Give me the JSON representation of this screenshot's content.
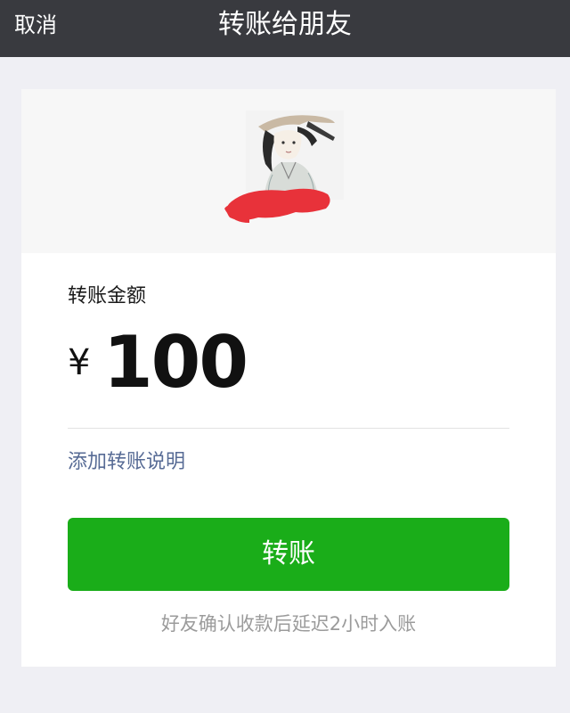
{
  "navbar": {
    "cancel_label": "取消",
    "title": "转账给朋友"
  },
  "recipient": {
    "avatar_icon": "avatar-illustration-icon",
    "name_mask_color": "#e8323a"
  },
  "transfer": {
    "amount_label": "转账金额",
    "currency_symbol": "¥",
    "amount": "100",
    "add_note_label": "添加转账说明",
    "button_label": "转账",
    "arrival_note": "好友确认收款后延迟2小时入账"
  },
  "colors": {
    "navbar_bg": "#393a3f",
    "primary_green": "#1aad19",
    "link_blue": "#576b95",
    "page_bg": "#efeff4"
  }
}
